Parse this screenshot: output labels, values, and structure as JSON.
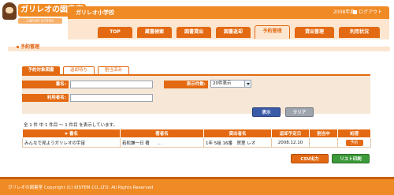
{
  "header": {
    "logo_text": "ガリレオの図書室",
    "logo_subtext": "LIBRARY SYSTEM",
    "school_name": "ガリレオ小学校",
    "fiscal_year": "2008年度",
    "logout_label": "ログアウト"
  },
  "nav": {
    "tabs": [
      {
        "label": "TOP"
      },
      {
        "label": "蔵書検索"
      },
      {
        "label": "図書貸出"
      },
      {
        "label": "図書返却"
      },
      {
        "label": "予約管理"
      },
      {
        "label": "貸出管理"
      },
      {
        "label": "利用状況"
      }
    ],
    "active_index": 4
  },
  "page": {
    "title": "予約管理"
  },
  "subtabs": [
    {
      "label": "予約対象図書"
    },
    {
      "label": "返却待ち"
    },
    {
      "label": "割当済み"
    }
  ],
  "form": {
    "book_title_label": "書名:",
    "book_title_value": "",
    "user_name_label": "利用者名:",
    "user_name_value": "",
    "display_count_label": "表示件数:",
    "display_count_value": "20件表示",
    "search_label": "表示",
    "clear_label": "クリア"
  },
  "results": {
    "summary": "全 1 件 中 1 件目 ～ 1 件目 を表示しています。",
    "columns": [
      "書名",
      "著者名",
      "貸出者名",
      "返却予定日",
      "割当中",
      "処理"
    ],
    "rows": [
      {
        "title": "みんなで見ようガリレオの宇宙",
        "author": "若松謙一日 著",
        "author_extra": "…",
        "borrower": "1年 5組 16番　賀里 レオ",
        "due_date": "2008.12.10",
        "assigned": "",
        "action": "予約"
      }
    ]
  },
  "actions": {
    "csv_label": "CSV出力",
    "print_label": "リスト印刷"
  },
  "footer": {
    "copyright": "ガリレオの図書室 Copyright (C) KISTEM CO.,LTD. All Rights Reserved"
  },
  "colors": {
    "accent": "#e36a12",
    "header_orange": "#f08a24",
    "nav_bg": "#fce6cf",
    "search_button": "#3a5ba8",
    "clear_button": "#9da4ae",
    "print_button": "#3d9a3a"
  }
}
